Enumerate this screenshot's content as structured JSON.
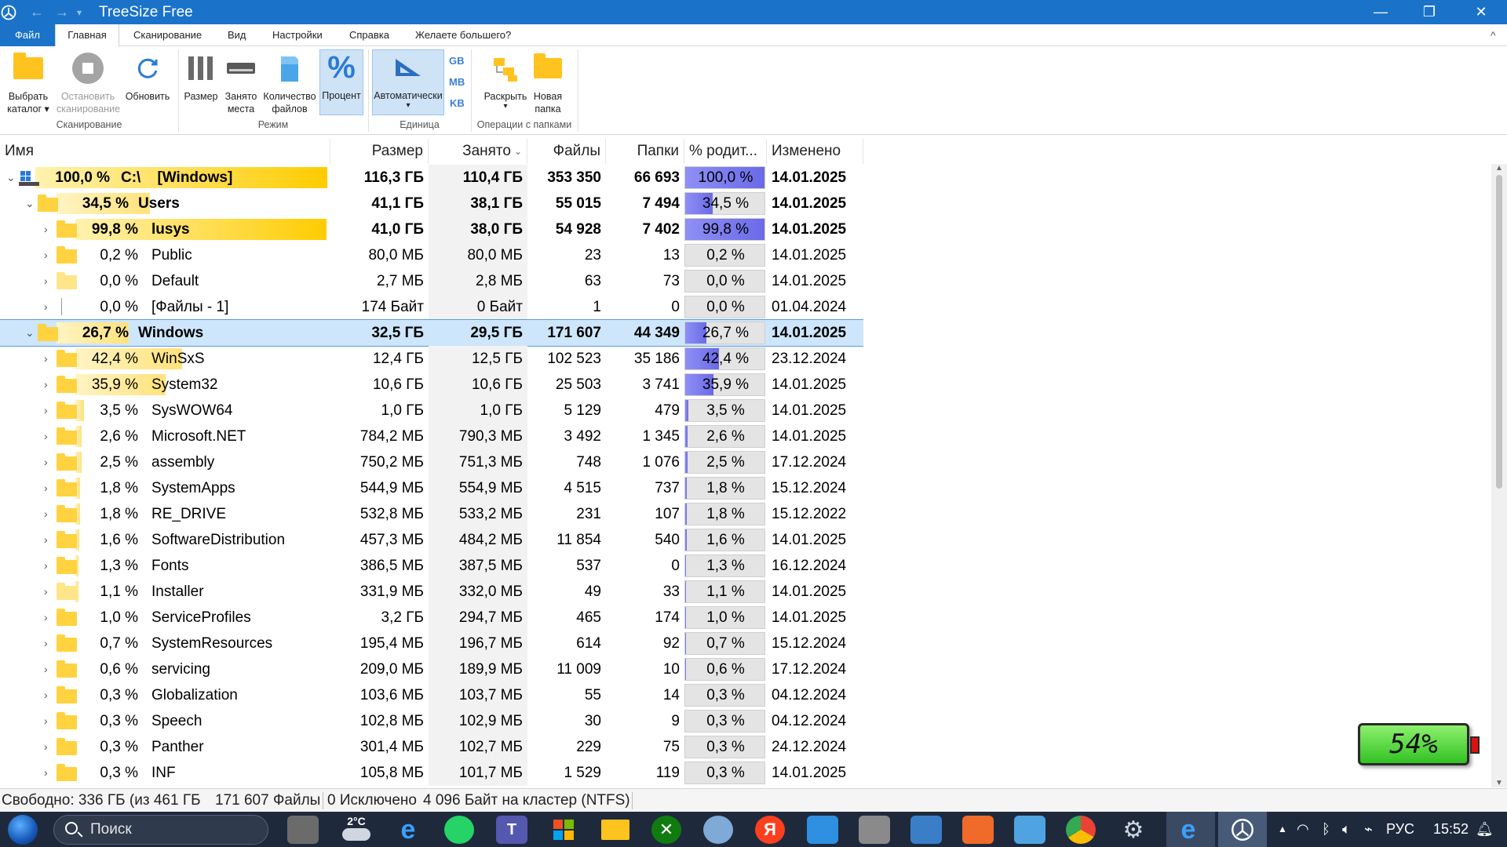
{
  "window": {
    "title": "TreeSize Free",
    "nav_back": "←",
    "nav_forward": "→",
    "nav_dropdown": "▾",
    "minimize": "—",
    "restore": "❐",
    "close": "✕"
  },
  "menu": {
    "file": "Файл",
    "tabs": [
      "Главная",
      "Сканирование",
      "Вид",
      "Настройки",
      "Справка",
      "Желаете большего?"
    ],
    "collapse": "^"
  },
  "ribbon": {
    "select_dir": [
      "Выбрать",
      "каталог ▾"
    ],
    "stop_scan": [
      "Остановить",
      "сканирование"
    ],
    "refresh": "Обновить",
    "group_scan": "Сканирование",
    "size": "Размер",
    "allocated": [
      "Занято",
      "места"
    ],
    "file_count": [
      "Количество",
      "файлов"
    ],
    "percent": "Процент",
    "group_mode": "Режим",
    "auto": [
      "Автоматически",
      "▾"
    ],
    "units": [
      "GB",
      "MB",
      "KB"
    ],
    "group_unit": "Единица",
    "expand": [
      "Раскрыть",
      "▾"
    ],
    "new_folder": [
      "Новая",
      "папка"
    ],
    "group_ops": "Операции с папками"
  },
  "columns": {
    "name": "Имя",
    "size": "Размер",
    "allocated": "Занято",
    "files": "Файлы",
    "folders": "Папки",
    "percent_parent": "% родит...",
    "modified": "Изменено"
  },
  "rows": [
    {
      "pct": "100,0 %",
      "name": "C:\\    [Windows]",
      "size": "116,3 ГБ",
      "alloc": "110,4 ГБ",
      "files": "353 350",
      "folders": "66 693",
      "ppct": "100,0 %",
      "pval": 1.0,
      "mod": "14.01.2025",
      "level": 0,
      "bold": true,
      "bar": 1.0,
      "type": "drive",
      "chev": "⌄"
    },
    {
      "pct": "34,5 %",
      "name": "Users",
      "size": "41,1 ГБ",
      "alloc": "38,1 ГБ",
      "files": "55 015",
      "folders": "7 494",
      "ppct": "34,5 %",
      "pval": 0.345,
      "mod": "14.01.2025",
      "level": 1,
      "bold": true,
      "bar": 0.345,
      "type": "folder",
      "chev": "⌄"
    },
    {
      "pct": "99,8 %",
      "name": "lusys",
      "size": "41,0 ГБ",
      "alloc": "38,0 ГБ",
      "files": "54 928",
      "folders": "7 402",
      "ppct": "99,8 %",
      "pval": 0.998,
      "mod": "14.01.2025",
      "level": 2,
      "bold": true,
      "bar": 0.998,
      "type": "folder",
      "chev": "›"
    },
    {
      "pct": "0,2 %",
      "name": "Public",
      "size": "80,0 МБ",
      "alloc": "80,0 МБ",
      "files": "23",
      "folders": "13",
      "ppct": "0,2 %",
      "pval": 0.002,
      "mod": "14.01.2025",
      "level": 2,
      "bold": false,
      "bar": 0.002,
      "type": "folder",
      "chev": "›"
    },
    {
      "pct": "0,0 %",
      "name": "Default",
      "size": "2,7 МБ",
      "alloc": "2,8 МБ",
      "files": "63",
      "folders": "73",
      "ppct": "0,0 %",
      "pval": 0.0,
      "mod": "14.01.2025",
      "level": 2,
      "bold": false,
      "bar": 0.0,
      "type": "pale",
      "chev": "›"
    },
    {
      "pct": "0,0 %",
      "name": "[Файлы - 1]",
      "size": "174 Байт",
      "alloc": "0 Байт",
      "files": "1",
      "folders": "0",
      "ppct": "0,0 %",
      "pval": 0.0,
      "mod": "01.04.2024",
      "level": 2,
      "bold": false,
      "bar": 0.0,
      "type": "files",
      "chev": "›"
    },
    {
      "pct": "26,7 %",
      "name": "Windows",
      "size": "32,5 ГБ",
      "alloc": "29,5 ГБ",
      "files": "171 607",
      "folders": "44 349",
      "ppct": "26,7 %",
      "pval": 0.267,
      "mod": "14.01.2025",
      "level": 1,
      "bold": true,
      "bar": 0.267,
      "type": "folder",
      "chev": "⌄",
      "selected": true
    },
    {
      "pct": "42,4 %",
      "name": "WinSxS",
      "size": "12,4 ГБ",
      "alloc": "12,5 ГБ",
      "files": "102 523",
      "folders": "35 186",
      "ppct": "42,4 %",
      "pval": 0.424,
      "mod": "23.12.2024",
      "level": 2,
      "bold": false,
      "bar": 0.424,
      "type": "folder",
      "chev": "›"
    },
    {
      "pct": "35,9 %",
      "name": "System32",
      "size": "10,6 ГБ",
      "alloc": "10,6 ГБ",
      "files": "25 503",
      "folders": "3 741",
      "ppct": "35,9 %",
      "pval": 0.359,
      "mod": "14.01.2025",
      "level": 2,
      "bold": false,
      "bar": 0.359,
      "type": "folder",
      "chev": "›"
    },
    {
      "pct": "3,5 %",
      "name": "SysWOW64",
      "size": "1,0 ГБ",
      "alloc": "1,0 ГБ",
      "files": "5 129",
      "folders": "479",
      "ppct": "3,5 %",
      "pval": 0.035,
      "mod": "14.01.2025",
      "level": 2,
      "bold": false,
      "bar": 0.035,
      "type": "folder",
      "chev": "›"
    },
    {
      "pct": "2,6 %",
      "name": "Microsoft.NET",
      "size": "784,2 МБ",
      "alloc": "790,3 МБ",
      "files": "3 492",
      "folders": "1 345",
      "ppct": "2,6 %",
      "pval": 0.026,
      "mod": "14.01.2025",
      "level": 2,
      "bold": false,
      "bar": 0.026,
      "type": "folder",
      "chev": "›"
    },
    {
      "pct": "2,5 %",
      "name": "assembly",
      "size": "750,2 МБ",
      "alloc": "751,3 МБ",
      "files": "748",
      "folders": "1 076",
      "ppct": "2,5 %",
      "pval": 0.025,
      "mod": "17.12.2024",
      "level": 2,
      "bold": false,
      "bar": 0.025,
      "type": "folder",
      "chev": "›"
    },
    {
      "pct": "1,8 %",
      "name": "SystemApps",
      "size": "544,9 МБ",
      "alloc": "554,9 МБ",
      "files": "4 515",
      "folders": "737",
      "ppct": "1,8 %",
      "pval": 0.018,
      "mod": "15.12.2024",
      "level": 2,
      "bold": false,
      "bar": 0.018,
      "type": "folder",
      "chev": "›"
    },
    {
      "pct": "1,8 %",
      "name": "RE_DRIVE",
      "size": "532,8 МБ",
      "alloc": "533,2 МБ",
      "files": "231",
      "folders": "107",
      "ppct": "1,8 %",
      "pval": 0.018,
      "mod": "15.12.2022",
      "level": 2,
      "bold": false,
      "bar": 0.018,
      "type": "folder",
      "chev": "›"
    },
    {
      "pct": "1,6 %",
      "name": "SoftwareDistribution",
      "size": "457,3 МБ",
      "alloc": "484,2 МБ",
      "files": "11 854",
      "folders": "540",
      "ppct": "1,6 %",
      "pval": 0.016,
      "mod": "14.01.2025",
      "level": 2,
      "bold": false,
      "bar": 0.016,
      "type": "folder",
      "chev": "›"
    },
    {
      "pct": "1,3 %",
      "name": "Fonts",
      "size": "386,5 МБ",
      "alloc": "387,5 МБ",
      "files": "537",
      "folders": "0",
      "ppct": "1,3 %",
      "pval": 0.013,
      "mod": "16.12.2024",
      "level": 2,
      "bold": false,
      "bar": 0.013,
      "type": "folder",
      "chev": "›"
    },
    {
      "pct": "1,1 %",
      "name": "Installer",
      "size": "331,9 МБ",
      "alloc": "332,0 МБ",
      "files": "49",
      "folders": "33",
      "ppct": "1,1 %",
      "pval": 0.011,
      "mod": "14.01.2025",
      "level": 2,
      "bold": false,
      "bar": 0.011,
      "type": "pale",
      "chev": "›"
    },
    {
      "pct": "1,0 %",
      "name": "ServiceProfiles",
      "size": "3,2 ГБ",
      "alloc": "294,7 МБ",
      "files": "465",
      "folders": "174",
      "ppct": "1,0 %",
      "pval": 0.01,
      "mod": "14.01.2025",
      "level": 2,
      "bold": false,
      "bar": 0.01,
      "type": "folder",
      "chev": "›"
    },
    {
      "pct": "0,7 %",
      "name": "SystemResources",
      "size": "195,4 МБ",
      "alloc": "196,7 МБ",
      "files": "614",
      "folders": "92",
      "ppct": "0,7 %",
      "pval": 0.007,
      "mod": "15.12.2024",
      "level": 2,
      "bold": false,
      "bar": 0.007,
      "type": "folder",
      "chev": "›"
    },
    {
      "pct": "0,6 %",
      "name": "servicing",
      "size": "209,0 МБ",
      "alloc": "189,9 МБ",
      "files": "11 009",
      "folders": "10",
      "ppct": "0,6 %",
      "pval": 0.006,
      "mod": "17.12.2024",
      "level": 2,
      "bold": false,
      "bar": 0.006,
      "type": "folder",
      "chev": "›"
    },
    {
      "pct": "0,3 %",
      "name": "Globalization",
      "size": "103,6 МБ",
      "alloc": "103,7 МБ",
      "files": "55",
      "folders": "14",
      "ppct": "0,3 %",
      "pval": 0.003,
      "mod": "04.12.2024",
      "level": 2,
      "bold": false,
      "bar": 0.003,
      "type": "folder",
      "chev": "›"
    },
    {
      "pct": "0,3 %",
      "name": "Speech",
      "size": "102,8 МБ",
      "alloc": "102,9 МБ",
      "files": "30",
      "folders": "9",
      "ppct": "0,3 %",
      "pval": 0.003,
      "mod": "04.12.2024",
      "level": 2,
      "bold": false,
      "bar": 0.003,
      "type": "folder",
      "chev": "›"
    },
    {
      "pct": "0,3 %",
      "name": "Panther",
      "size": "301,4 МБ",
      "alloc": "102,7 МБ",
      "files": "229",
      "folders": "75",
      "ppct": "0,3 %",
      "pval": 0.003,
      "mod": "24.12.2024",
      "level": 2,
      "bold": false,
      "bar": 0.003,
      "type": "folder",
      "chev": "›"
    },
    {
      "pct": "0,3 %",
      "name": "INF",
      "size": "105,8 МБ",
      "alloc": "101,7 МБ",
      "files": "1 529",
      "folders": "119",
      "ppct": "0,3 %",
      "pval": 0.003,
      "mod": "14.01.2025",
      "level": 2,
      "bold": false,
      "bar": 0.003,
      "type": "folder",
      "chev": "›"
    }
  ],
  "battery": {
    "label": "54%",
    "level": 0.54
  },
  "status": {
    "free": "Свободно: 336 ГБ  (из 461 ГБ",
    "files": "171 607 Файлы",
    "excluded": "0 Исключено",
    "cluster": "4 096 Байт на кластер (NTFS)"
  },
  "taskbar": {
    "search_placeholder": "Поиск",
    "weather": "2°C",
    "lang": "РУС",
    "time": "15:52"
  },
  "colors": {
    "accent": "#1a73c9",
    "folder": "#ffd23f",
    "percent_fill": "#7b7bf0",
    "selection": "#cde6fb"
  }
}
